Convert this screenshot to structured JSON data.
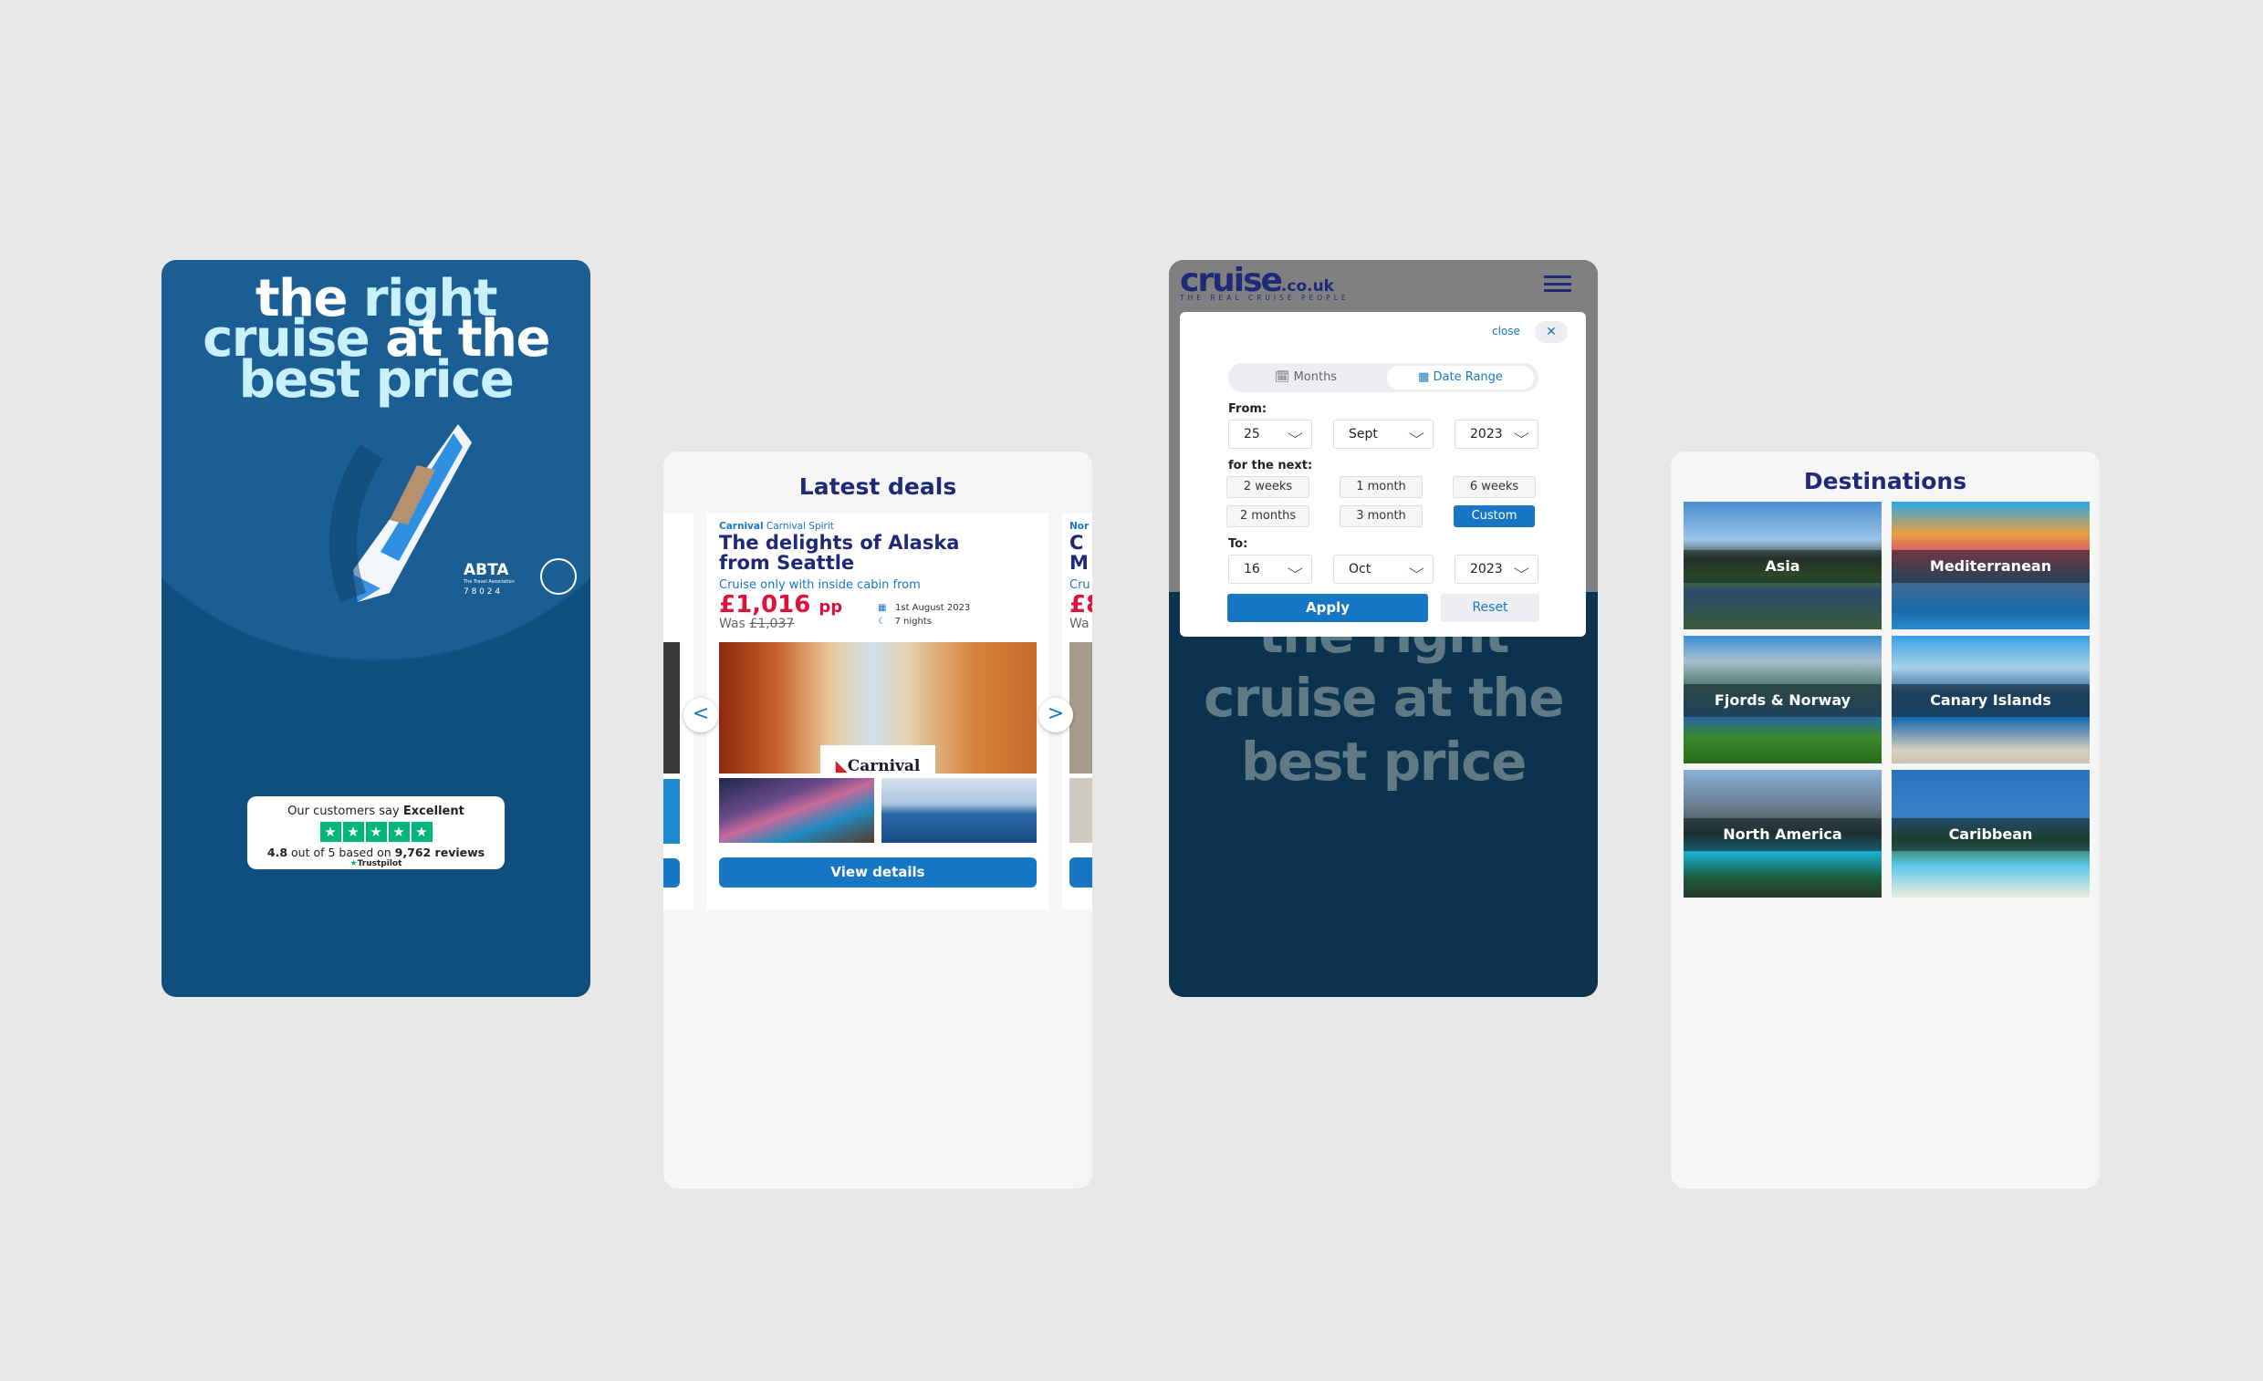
{
  "hero": {
    "line1a": "the",
    "line1b": "right",
    "line2a": "cruise",
    "line2b": "at the",
    "line3": "best price",
    "abta": "ABTA",
    "abta_sub": "The Travel Association",
    "abta_number": "7 8 0 2 4",
    "trustpilot": {
      "say": "Our customers say",
      "rating_word": "Excellent",
      "score": "4.8",
      "out_of": "out of 5 based on",
      "reviews": "9,762 reviews",
      "brand": "Trustpilot",
      "stars": 5
    }
  },
  "deals": {
    "title": "Latest deals",
    "card": {
      "line": "Carnival",
      "ship": "Carnival Spirit",
      "title1": "The delights of Alaska",
      "title2": "from Seattle",
      "subtitle": "Cruise only with inside cabin from",
      "price": "£1,016",
      "price_unit": "pp",
      "was_label": "Was",
      "was_price": "£1,037",
      "date": "1st August 2023",
      "nights": "7 nights",
      "logo": "Carnival",
      "button": "View details"
    },
    "next_card": {
      "line": "Nor",
      "title1": "C",
      "title2": "M",
      "subtitle": "Cru",
      "price": "£8",
      "was": "Wa"
    },
    "prev_label": "<",
    "next_label": ">"
  },
  "search": {
    "logo": "cruise",
    "logo_suffix": ".co.uk",
    "tagline": "THE REAL CRUISE PEOPLE",
    "close": "close",
    "tabs": [
      {
        "label": "Months",
        "active": false
      },
      {
        "label": "Date Range",
        "active": true
      }
    ],
    "from_label": "From:",
    "from": {
      "day": "25",
      "month": "Sept",
      "year": "2023"
    },
    "next_label": "for the next:",
    "options": [
      "2 weeks",
      "1 month",
      "6 weeks",
      "2 months",
      "3 month",
      "Custom"
    ],
    "selected_option": "Custom",
    "to_label": "To:",
    "to": {
      "day": "16",
      "month": "Oct",
      "year": "2023"
    },
    "apply": "Apply",
    "reset": "Reset",
    "bg_line1": "the right",
    "bg_line2": "cruise at the",
    "bg_line3": "best price"
  },
  "destinations": {
    "title": "Destinations",
    "items": [
      "Asia",
      "Mediterranean",
      "Fjords & Norway",
      "Canary Islands",
      "North America",
      "Caribbean"
    ]
  },
  "colors": {
    "navy": "#1e2a78",
    "blue": "#1777c4",
    "red": "#e0103c",
    "trustpilot": "#00b67a"
  }
}
